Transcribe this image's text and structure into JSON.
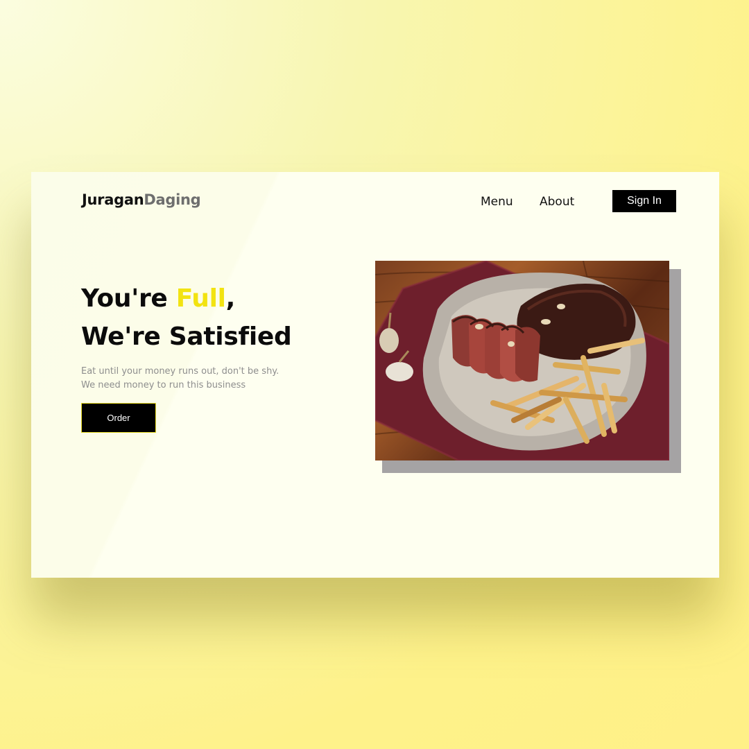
{
  "brand": {
    "part1": "Juragan",
    "part2": "Daging"
  },
  "nav": {
    "menu": "Menu",
    "about": "About",
    "signin": "Sign In"
  },
  "hero": {
    "line1_pre": "You're ",
    "line1_highlight": "Full",
    "line1_post": ",",
    "line2": "We're Satisfied",
    "sub1": "Eat until your money runs out, don't be shy.",
    "sub2": "We need money to run this business",
    "order": "Order"
  },
  "colors": {
    "accent": "#f2e311",
    "button": "#000000",
    "text": "#0b0b0b",
    "muted": "#8e8e8e"
  },
  "image": {
    "subject": "steak-with-fries-on-plate"
  }
}
